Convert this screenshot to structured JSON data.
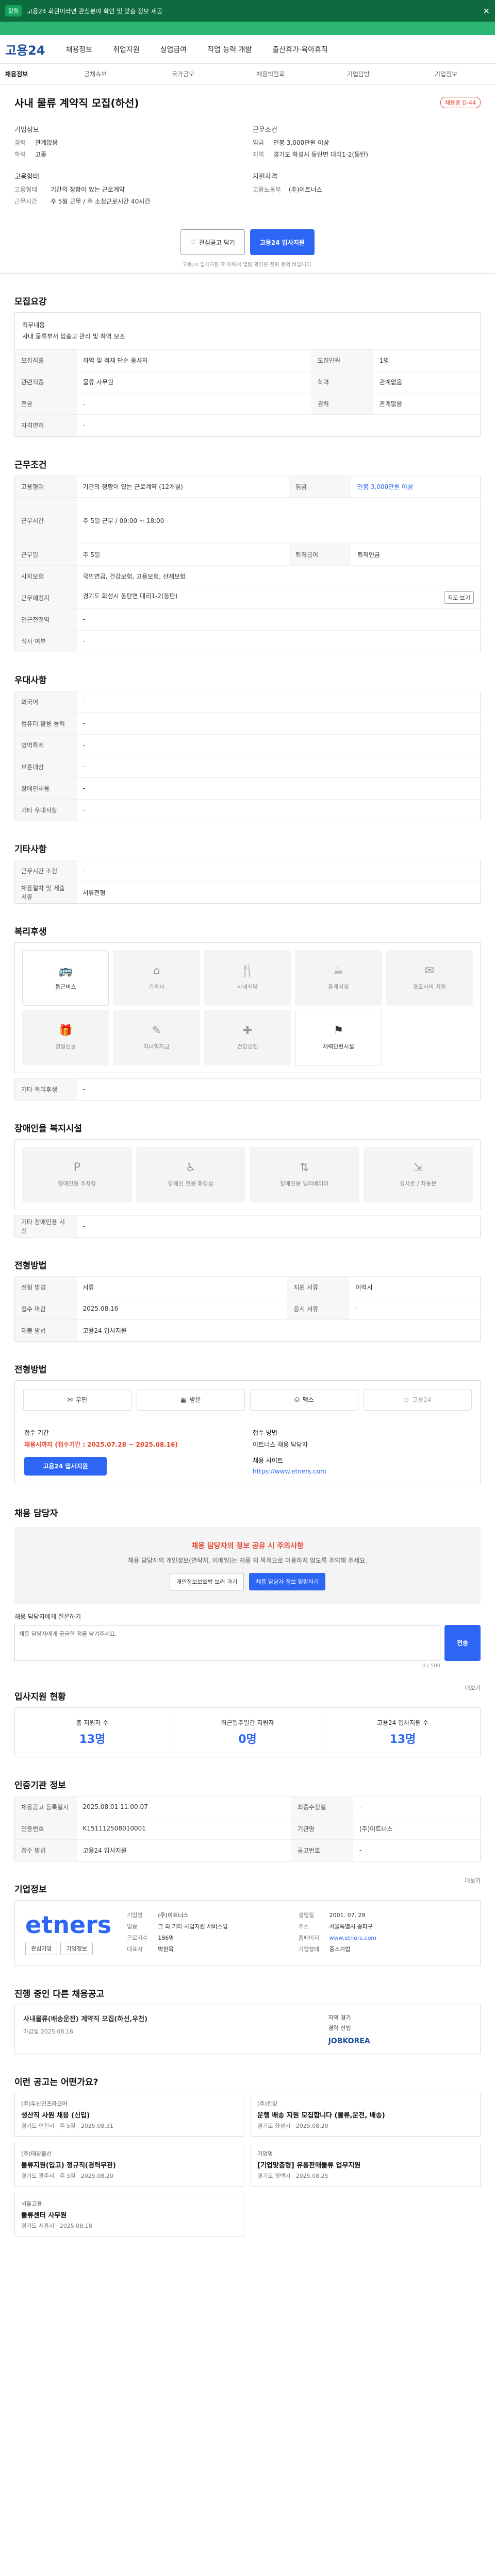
{
  "banner": {
    "tag": "알림",
    "text": "고용24 회원이라면 관심분야 확인 및 맞춤 정보 제공"
  },
  "gnb": {
    "logo": "고용24",
    "items": [
      "채용정보",
      "취업지원",
      "실업급여",
      "직업 능력 개발",
      "출산휴가·육아휴직"
    ]
  },
  "subnav": {
    "first": "채용정보",
    "items": [
      "공채속보",
      "국가공모",
      "채용박람회",
      "기업탐방",
      "기업정보"
    ]
  },
  "job": {
    "title": "사내 물류 계약직 모집(하선)",
    "badge": "채용중 D-44",
    "company_label": "기업정보",
    "company_name": "(주)이트너스",
    "rep": "고용노동부",
    "work_label": "근무조건",
    "pay_label": "임금",
    "pay": "연봉 3,000만원 이상",
    "region_label": "지역",
    "region": "경기도 화성시 동탄면 대리1-2(동탄)",
    "skill_label": "지원자격",
    "career_label": "경력",
    "career": "관계없음",
    "edu_label": "학력",
    "edu": "고졸",
    "emp_label": "고용형태",
    "emp": "기간의 정함이 있는 근로계약",
    "hours_label": "근무시간",
    "hours": "주 5일 근무 / 주 소정근로시간 40시간"
  },
  "actions": {
    "scrap": "관심공고 담기",
    "apply": "고용24 입사지원",
    "note": "고용24 입사지원 후 이력서 열람 확인은 전화 문의 바랍니다."
  },
  "sections": {
    "recruit": "모집요강",
    "conditions": "근무조건",
    "benefit_wrap": "우대사항",
    "welfare": "복리후생",
    "disabled": "장애인을 복지시설",
    "requirements": "전형방법",
    "method": "전형방법",
    "stats": "입사지원 현황",
    "ref": "인증기관 정보",
    "company": "기업정보",
    "ongoing": "진행 중인 다른 채용공고",
    "similar": "이런 공고는 어떤가요?",
    "qna": "채용 담당자"
  },
  "recruit": {
    "desc_k": "직무내용",
    "desc": "사내 물류부서 입출고 관리 및 하역 보조",
    "type_k": "모집직종",
    "type": "하역 및 적재 단순 종사자",
    "people_k": "모집인원",
    "people": "1명",
    "work_k": "관련직종",
    "work": "물류 사무원",
    "edu_k": "학력",
    "edu": "관계없음",
    "major_k": "전공",
    "major": "-",
    "career_k": "경력",
    "career": "관계없음",
    "license_k": "자격면허",
    "license": "-"
  },
  "conditions": {
    "emp_k": "고용형태",
    "emp": "기간의 정함이 있는 근로계약 (12개월)",
    "pay_k": "임금",
    "pay": "연봉 3,000만원 이상",
    "time_k": "근무시간",
    "time": "주 5일 근무 / 09:00 ~ 18:00",
    "hol_k": "근무일",
    "hol": "주 5일",
    "ins_k": "사회보험",
    "ins": "국민연금, 건강보험, 고용보험, 산재보험",
    "ret_k": "퇴직급여",
    "ret": "퇴직연금",
    "loc_k": "근무예정지",
    "loc": "경기도 화성시 동탄면 대리1-2(동탄)",
    "loc_btn": "지도 보기",
    "near_k": "인근전철역",
    "near": "-",
    "sal_k": "식사 여부",
    "sal": "-"
  },
  "prefer": {
    "lang_k": "외국어",
    "lang": "-",
    "pc_k": "컴퓨터 활용 능력",
    "pc": "-",
    "mil_k": "병역특례",
    "mil": "-",
    "vet_k": "보훈대상",
    "vet": "-",
    "dis_k": "장애인채용",
    "dis": "-",
    "etc_k": "기타 우대사항",
    "etc": "-"
  },
  "other": {
    "title": "기타사항",
    "k1": "근무시간 조정",
    "v1": "-",
    "k2": "채용절차 및 제출서류",
    "v2": "서류전형"
  },
  "welfare": {
    "items": [
      "통근버스",
      "기숙사",
      "사내식당",
      "휴게시설",
      "경조사비 지원",
      "명절선물",
      "자녀학자금",
      "건강검진",
      "체력단련시설"
    ],
    "extra_k": "기타 복리후생",
    "extra": "-"
  },
  "disabled_items": {
    "items": [
      "장애인용 주차장",
      "장애인 전용 화장실",
      "장애인용 엘리베이터",
      "경사로 / 자동문"
    ],
    "extra_k": "기타 장애인용 시설",
    "extra": "-"
  },
  "selection": {
    "k1": "전형 방법",
    "v1": "서류",
    "k2": "지원 서류",
    "v2": "이력서",
    "k3": "접수 마감",
    "v3": "2025.08.16",
    "k4": "응시 서류",
    "v4": "-",
    "k5": "제출 방법",
    "v5": "고용24 입사지원"
  },
  "method": {
    "items": [
      "우편",
      "방문",
      "팩스",
      "고용24"
    ]
  },
  "apply": {
    "period_label": "접수 기간",
    "period": "채용시까지 (접수기간 : 2025.07.28 ~ 2025.08.16)",
    "apply_btn": "고용24 입사지원",
    "how_label": "접수 방법",
    "how": "이트너스 채용 담당자",
    "email_label": "채용 사이트",
    "email": "https://www.etners.com"
  },
  "warn": {
    "title": "채용 담당자의 정보 공유 시 주의사항",
    "text": "채용 담당자의 개인정보(연락처, 이메일)는 채용 외 목적으로 이용하지 않도록 주의해 주세요.",
    "b1": "개인정보보호법 보러 가기",
    "b2": "채용 담당자 정보 열람하기"
  },
  "qna": {
    "label": "채용 담당자에게 질문하기",
    "placeholder": "채용 담당자에게 궁금한 점을 남겨주세요.",
    "send": "전송",
    "count": "0 / 500"
  },
  "stats": {
    "items": [
      {
        "t": "총 지원자 수",
        "n": "13명"
      },
      {
        "t": "최근일주일간 지원자",
        "n": "0명"
      },
      {
        "t": "고용24 입사지원 수",
        "n": "13명"
      }
    ]
  },
  "ref": {
    "k1": "채용공고 등록일시",
    "v1": "2025.08.01 11:00:07",
    "k2": "최종수정일",
    "v2": "-",
    "k3": "인증번호",
    "v3": "K151112508010001",
    "k4": "기관명",
    "v4": "(주)이트너스",
    "k5": "접수 방법",
    "v5": "고용24 입사지원",
    "k6": "공고번호",
    "v6": "-"
  },
  "company": {
    "logo": "etners",
    "k1": "기업명",
    "v1": "(주)이트너스",
    "k2": "업종",
    "v2": "그 외 기타 사업지원 서비스업",
    "k3": "근로자수",
    "v3": "186명",
    "k4": "대표자",
    "v4": "박한목",
    "k5": "설립일",
    "v5": "2001. 07. 28",
    "k6": "주소",
    "v6": "서울특별시 송파구",
    "k7": "홈페이지",
    "v7": "www.etners.com",
    "k8": "기업형태",
    "v8": "중소기업",
    "btn1": "관심기업",
    "btn2": "기업정보"
  },
  "ongoing": {
    "co": "JOBKOREA",
    "title": "사내물류(배송운전) 계약직 모집(하선,우천)",
    "k1": "지역",
    "v1": "경기",
    "k2": "경력",
    "v2": "신입",
    "date": "마감일 2025.08.16"
  },
  "similar": [
    {
      "co": "(주)두산인프라코어",
      "tt": "생산직 사원 채용 (신입)",
      "meta": "경기도 인천시 · 주 5일 · 2025.08.31"
    },
    {
      "co": "(주)한양",
      "tt": "운행 배송 지원 모집합니다 (물류,운전, 배송)",
      "meta": "경기도 화성시 · 2025.08.20"
    },
    {
      "co": "(주)태광물산",
      "tt": "물류지원(입고) 정규직(경력무관)",
      "meta": "경기도 광주시 · 주 5일 · 2025.08.20"
    },
    {
      "co": "기업명",
      "tt": "[기업맞춤형] 유통판매물류 업무지원",
      "meta": "경기도 평택시 · 2025.08.25"
    },
    {
      "co": "서울고용",
      "tt": "물류센터 사무원",
      "meta": "경기도 시흥시 · 2025.08.18"
    }
  ],
  "more": "더보기"
}
